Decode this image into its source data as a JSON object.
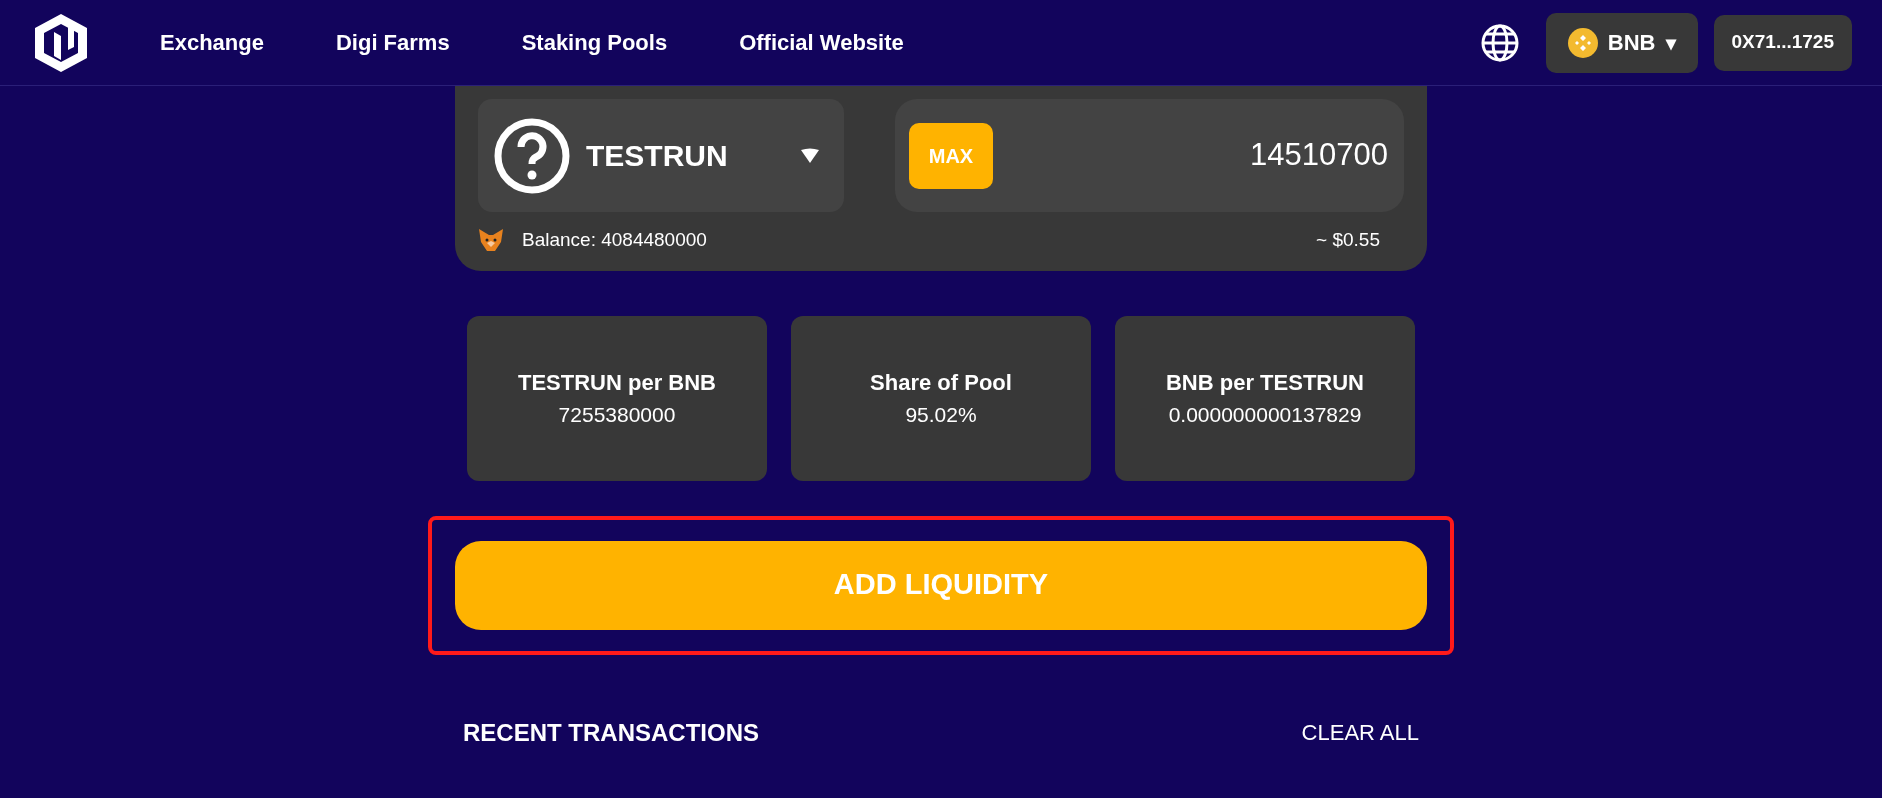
{
  "nav": {
    "links": [
      "Exchange",
      "Digi Farms",
      "Staking Pools",
      "Official Website"
    ],
    "network": "BNB",
    "network_caret": "▾",
    "wallet": "0X71...1725"
  },
  "token_input": {
    "token": "TESTRUN",
    "max_label": "MAX",
    "amount": "14510700",
    "balance": "Balance: 4084480000",
    "usd": "~ $0.55"
  },
  "stats": [
    {
      "label": "TESTRUN per BNB",
      "value": "7255380000"
    },
    {
      "label": "Share of Pool",
      "value": "95.02%"
    },
    {
      "label": "BNB per TESTRUN",
      "value": "0.000000000137829"
    }
  ],
  "action": {
    "label": "ADD LIQUIDITY",
    "highlighted": true
  },
  "recent": {
    "title": "RECENT TRANSACTIONS",
    "clear": "CLEAR ALL"
  }
}
